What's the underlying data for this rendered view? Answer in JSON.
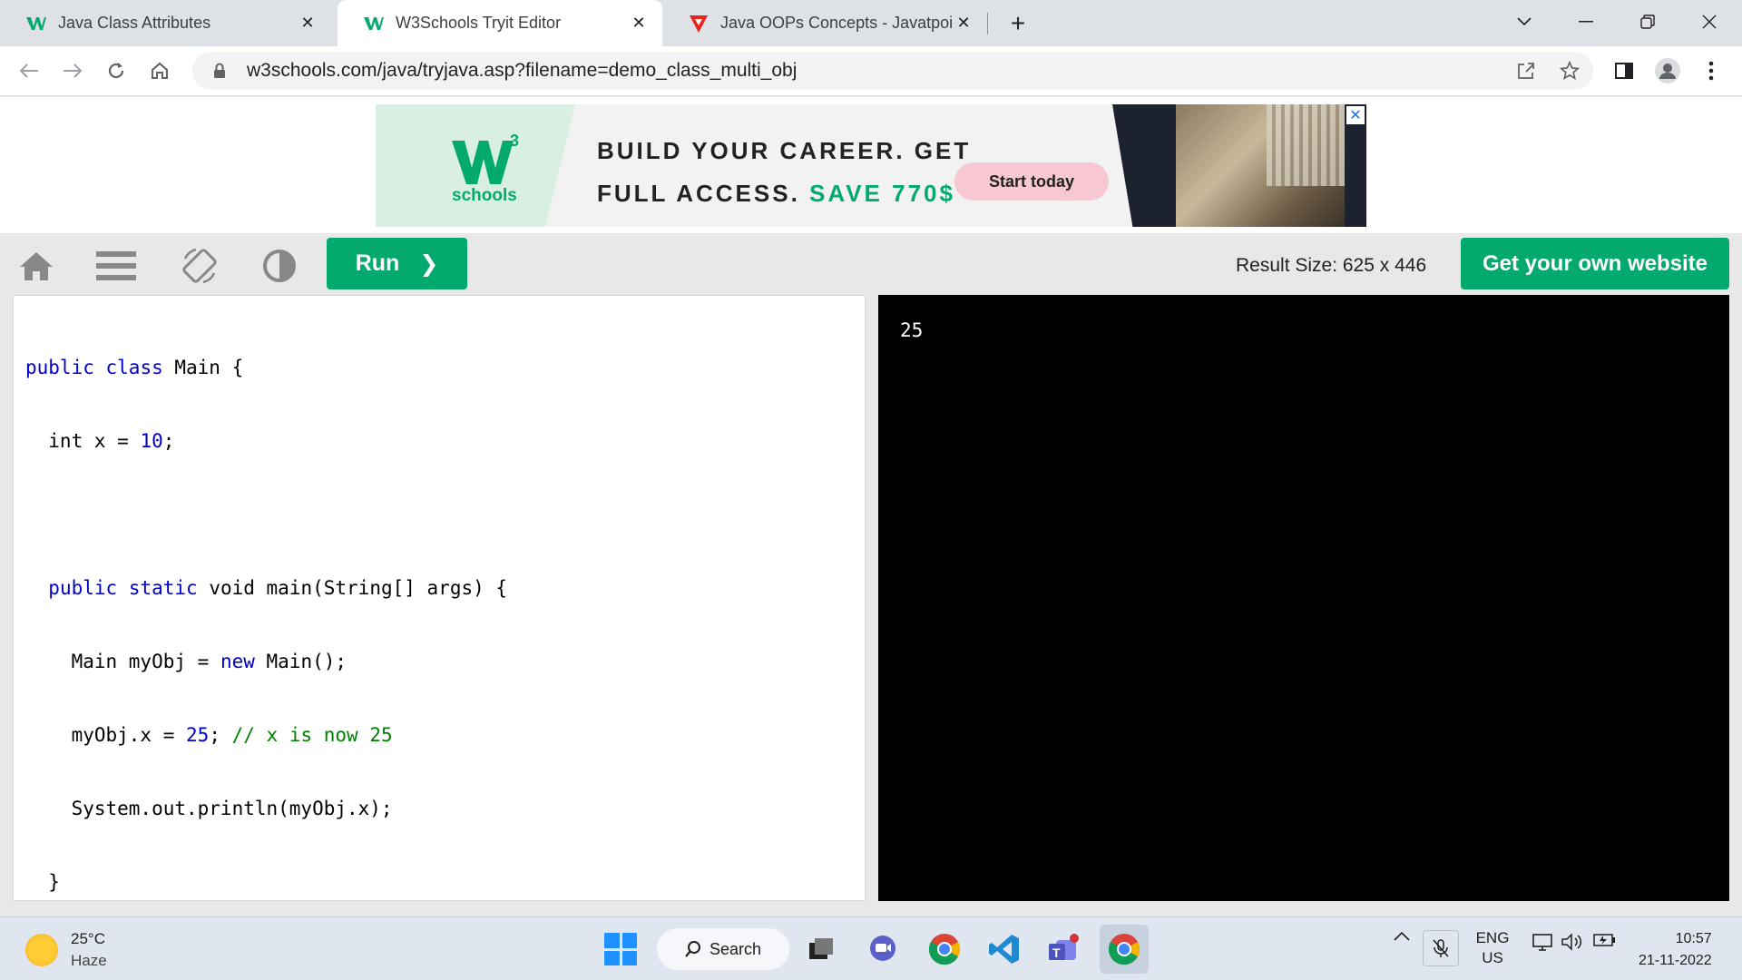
{
  "browser": {
    "tabs": [
      {
        "title": "Java Class Attributes",
        "favicon": "w3schools-icon",
        "active": false
      },
      {
        "title": "W3Schools Tryit Editor",
        "favicon": "w3schools-icon",
        "active": true
      },
      {
        "title": "Java OOPs Concepts - Javatpoint",
        "favicon": "javatpoint-icon",
        "active": false
      }
    ],
    "new_tab_label": "+",
    "url": "w3schools.com/java/tryjava.asp?filename=demo_class_multi_obj"
  },
  "ad": {
    "logo_text": "schools",
    "line1": "BUILD YOUR CAREER. GET",
    "line2_prefix": "FULL ACCESS.",
    "line2_save": "SAVE 770$",
    "cta": "Start today",
    "close": "✕"
  },
  "tryit": {
    "run_label": "Run",
    "run_chevron": "❯",
    "result_size": "Result Size: 625 x 446",
    "get_website": "Get your own website"
  },
  "editor": {
    "language": "java",
    "lines": [
      "public class Main {",
      "  int x = 10;",
      "",
      "  public static void main(String[] args) {",
      "    Main myObj = new Main();",
      "    myObj.x = 25; // x is now 25",
      "    System.out.println(myObj.x);",
      "  }",
      "}"
    ]
  },
  "result": {
    "output": "25"
  },
  "taskbar": {
    "weather_temp": "25°C",
    "weather_cond": "Haze",
    "search_label": "Search",
    "lang_top": "ENG",
    "lang_bottom": "US",
    "time": "10:57",
    "date": "21-11-2022"
  },
  "colors": {
    "accent": "#04aa6d",
    "result_bg": "#000000",
    "keyword": "#0000cd",
    "comment": "#008000"
  }
}
